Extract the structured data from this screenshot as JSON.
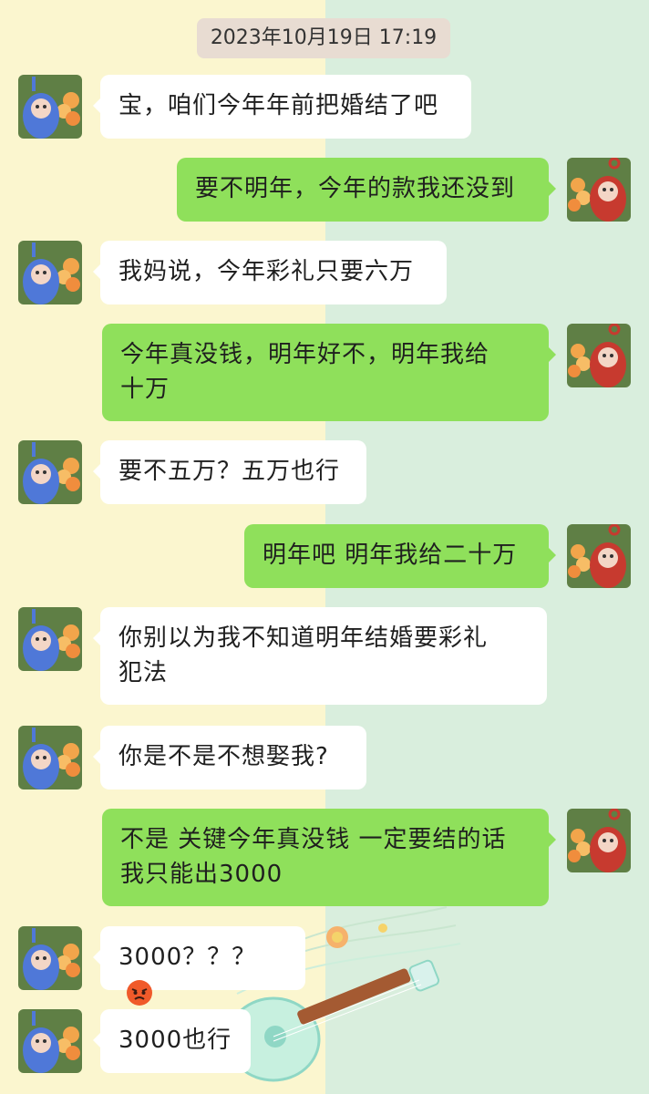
{
  "timestamp": "2023年10月19日 17:19",
  "colors": {
    "left_background": "#fbf6cf",
    "right_background": "#d9eedd",
    "incoming_bubble": "#ffffff",
    "outgoing_bubble": "#8fe05b"
  },
  "avatars": {
    "incoming": "blue-teletubby-avatar",
    "outgoing": "red-teletubby-avatar"
  },
  "messages": [
    {
      "side": "incoming",
      "text": "宝，咱们今年年前把婚结了吧"
    },
    {
      "side": "outgoing",
      "text": "要不明年，今年的款我还没到"
    },
    {
      "side": "incoming",
      "text": "我妈说，今年彩礼只要六万"
    },
    {
      "side": "outgoing",
      "line1": "今年真没钱，明年好不，明年我给",
      "line2": "十万"
    },
    {
      "side": "incoming",
      "text": "要不五万？五万也行"
    },
    {
      "side": "outgoing",
      "text": "明年吧 明年我给二十万"
    },
    {
      "side": "incoming",
      "line1": "你别以为我不知道明年结婚要彩礼",
      "line2": "犯法"
    },
    {
      "side": "incoming",
      "text": "你是不是不想娶我?"
    },
    {
      "side": "outgoing",
      "line1": "不是 关键今年真没钱 一定要结的话",
      "line2": "我只能出3000"
    },
    {
      "side": "incoming",
      "text": "3000？？？",
      "emoji": "angry-face-icon"
    },
    {
      "side": "incoming",
      "text": "3000也行"
    }
  ],
  "decoration": "ukulele-sticker"
}
